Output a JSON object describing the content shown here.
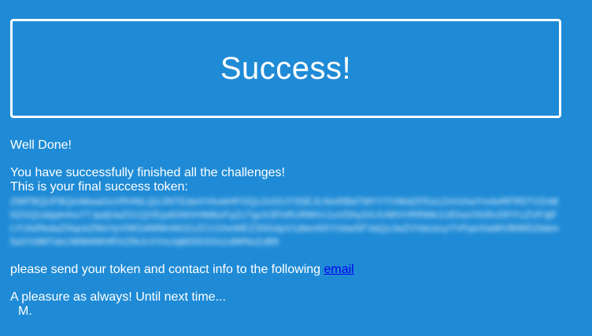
{
  "banner": {
    "title": "Success!"
  },
  "message": {
    "well_done": "Well Done!",
    "finished": "You have successfully finished all the challenges!",
    "token_intro": "This is your final success token:",
    "token": "ZWFBQUFBQmMwaGxVRHNLQUJNTEdwVVkxbHFOQzJUOUY3SEJLNmRBdTMYYYVWdZFEa1ZnVzhaYm4xRFR5TVZnM0ZGQUdqdmhsYTJpdjVaZG1QVEpdGNtVHlMbzFpZzTgxX3FhRURMVc1uVDhySXJUWVVRRWk1UEhaVXhRcDFlYzZVFdjFLYUlsRkdaZ0tqckZMeVyVlW2dWMnNOZzZCU1heWEZ3SGdyV1dtenNXYmtwSFVaQzJwZVVaUzcyYVFpeXlaWVBlWDZkbm5aVVdMTdsUWM4WHRXZlNJcVVmJqM2lGSGs1dWNsZzB9",
    "send_prefix": "please send your token and contact info to the following ",
    "email_link": "email",
    "closing": "A pleasure as always! Until next time...",
    "signature": "M."
  },
  "colors": {
    "background": "#1f8bd6",
    "text": "#ffffff",
    "link": "#0000ee"
  }
}
